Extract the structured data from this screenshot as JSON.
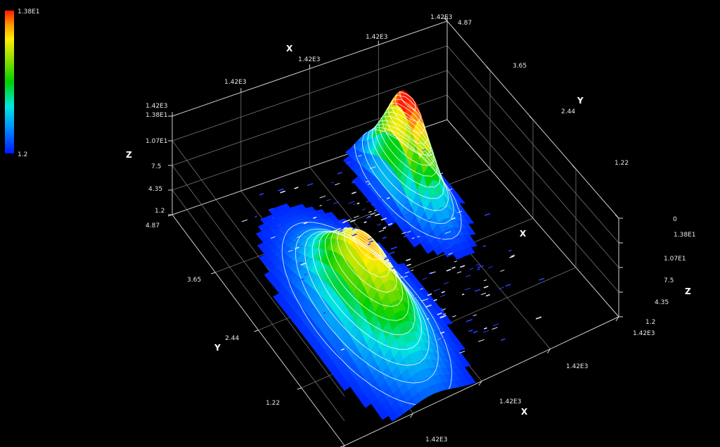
{
  "chart_data": {
    "type": "surface-3d",
    "colorbar": {
      "max_label": "1.38E1",
      "min_label": "1.2",
      "min": 1.2,
      "max": 13.8
    },
    "axes": {
      "x": {
        "label": "X",
        "ticks": [
          "1.42E3",
          "1.42E3",
          "1.42E3",
          "1.42E3"
        ]
      },
      "y": {
        "label": "Y",
        "ticks": [
          "4.87",
          "3.65",
          "2.44",
          "1.22",
          "0"
        ]
      },
      "z": {
        "label": "Z",
        "ticks": [
          "1.38E1",
          "1.07E1",
          "7.5",
          "4.35",
          "1.2"
        ],
        "min": 1.2,
        "max": 13.8
      }
    },
    "corner_labels": {
      "x_max_far": "1.42E3",
      "x_min_far": "1.42E3",
      "x_near_end": "1.42E3",
      "y_max_left": "4.87",
      "y_max_top": "4.87",
      "y_zero_right": "0"
    },
    "surface": {
      "peaks": [
        {
          "name": "",
          "x": 0.32,
          "y": 0.62,
          "height": 11.6
        },
        {
          "name": "",
          "x": 0.72,
          "y": 0.22,
          "height": 13.8
        }
      ],
      "grid": {
        "zero_level": 1.2
      },
      "contour_lines": "white"
    },
    "grid": true
  }
}
